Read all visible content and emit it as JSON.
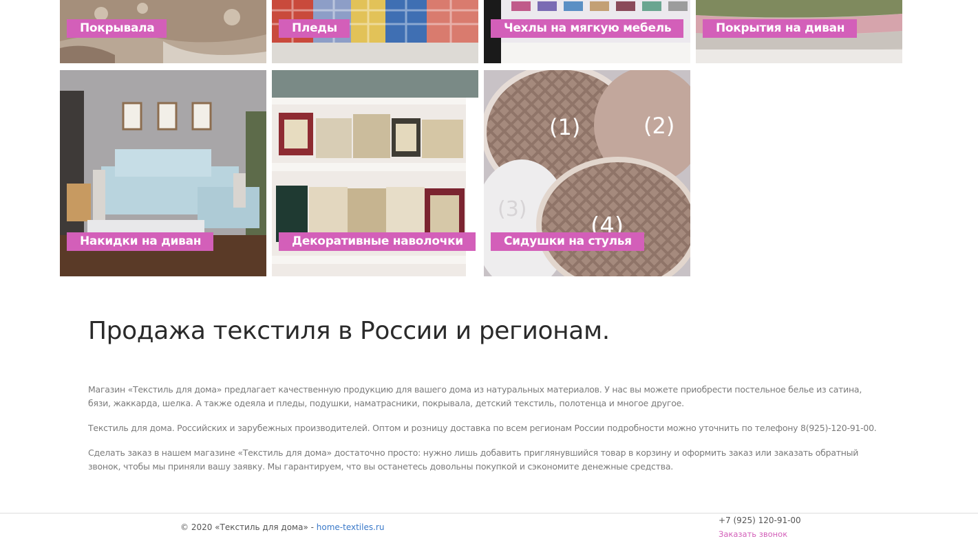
{
  "catalog": {
    "row1": [
      {
        "label": "Покрывала",
        "image": "bedspread-photo"
      },
      {
        "label": "Пледы",
        "image": "plaids-photo"
      },
      {
        "label": "Чехлы на мягкую мебель",
        "image": "furniture-covers-photo"
      },
      {
        "label": "Покрытия на диван",
        "image": "sofa-coverings-photo"
      }
    ],
    "row2": [
      {
        "label": "Накидки на диван",
        "image": "sofa-throws-photo"
      },
      {
        "label": "Декоративные наволочки",
        "image": "decorative-pillowcases-photo"
      },
      {
        "label": "Сидушки на стулья",
        "image": "chair-pads-photo"
      }
    ],
    "chair_pad_numbers": [
      "(1)",
      "(2)",
      "(3)",
      "(4)"
    ]
  },
  "content": {
    "headline": "Продажа текстиля в России и регионам.",
    "paragraphs": [
      "Магазин «Текстиль для дома» предлагает качественную продукцию для вашего дома из натуральных материалов. У нас вы можете приобрести постельное белье из сатина, бязи, жаккарда, шелка. А также одеяла и пледы, подушки, наматрасники, покрывала, детский текстиль, полотенца и многое другое.",
      "Текстиль для дома. Российских и зарубежных производителей. Оптом и розницу доставка по всем регионам России подробности можно уточнить по телефону 8(925)-120-91-00.",
      "Сделать заказ в нашем магазине «Текстиль для дома» достаточно просто: нужно лишь добавить приглянувшийся товар в корзину и оформить заказ или заказать обратный звонок, чтобы мы приняли вашу заявку. Мы гарантируем, что вы останетесь довольны покупкой и сэкономите денежные средства."
    ]
  },
  "footer": {
    "copyright": "© 2020 «Текстиль для дома» - ",
    "site_link": "home-textiles.ru",
    "phone": "+7 (925) 120-91-00",
    "callback": "Заказать звонок"
  },
  "colors": {
    "label_bg": "#d35fb9",
    "link": "#3a79c9"
  }
}
